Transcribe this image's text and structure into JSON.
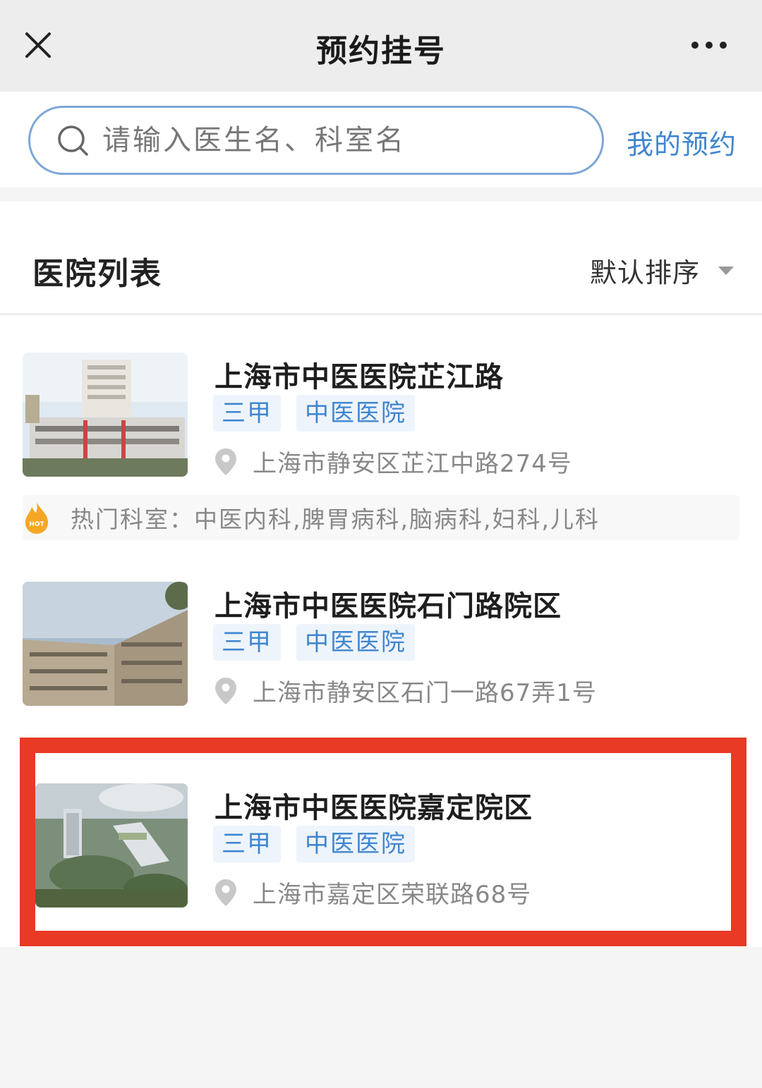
{
  "nav": {
    "title": "预约挂号",
    "close_icon": "close-icon",
    "more_icon": "more-icon"
  },
  "search": {
    "placeholder": "请输入医生名、科室名",
    "value": "",
    "my_appointments": "我的预约"
  },
  "list": {
    "title": "医院列表",
    "sort_label": "默认排序"
  },
  "hospitals": [
    {
      "name": "上海市中医医院芷江路",
      "tags": [
        "三甲",
        "中医医院"
      ],
      "address": "上海市静安区芷江中路274号",
      "hot_label": "热门科室：",
      "hot_departments": "中医内科,脾胃病科,脑病科,妇科,儿科"
    },
    {
      "name": "上海市中医医院石门路院区",
      "tags": [
        "三甲",
        "中医医院"
      ],
      "address": "上海市静安区石门一路67弄1号"
    },
    {
      "name": "上海市中医医院嘉定院区",
      "tags": [
        "三甲",
        "中医医院"
      ],
      "address": "上海市嘉定区荣联路68号"
    }
  ],
  "colors": {
    "accent": "#3f86cf",
    "highlight": "#e83a24",
    "tag_bg": "#eef4fb"
  }
}
